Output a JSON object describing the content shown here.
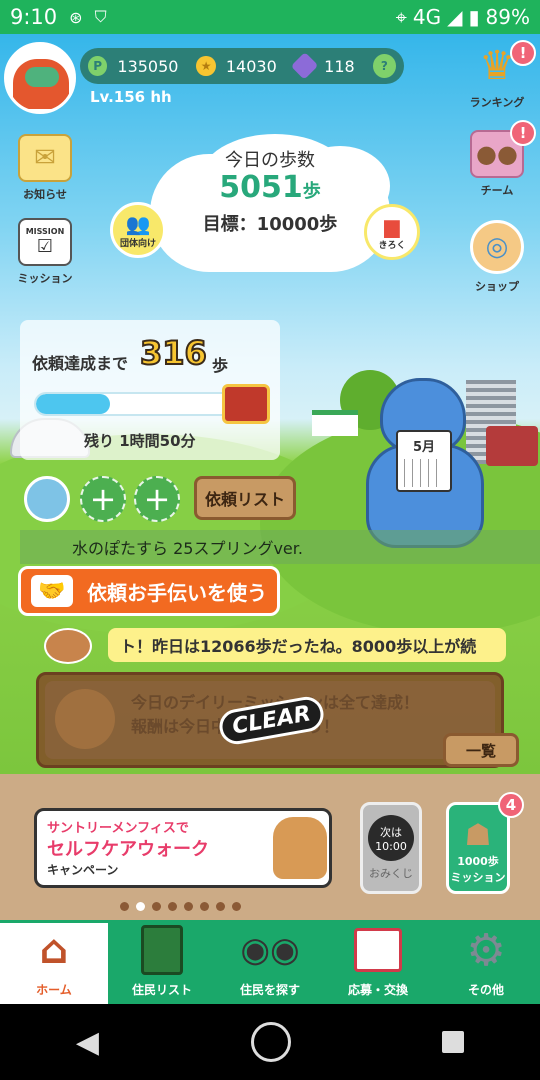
{
  "status_bar": {
    "time": "9:10",
    "network": "4G",
    "battery": "89%"
  },
  "header": {
    "points": "135050",
    "coins": "14030",
    "gems": "118",
    "help": "?",
    "level": "Lv.156 hh"
  },
  "side_left": [
    {
      "label": "お知らせ"
    },
    {
      "label": "ミッション",
      "sign": "MISSION"
    }
  ],
  "side_right": [
    {
      "label": "ランキング",
      "badge": "!"
    },
    {
      "label": "チーム",
      "badge": "!"
    },
    {
      "label": "ショップ"
    }
  ],
  "steps": {
    "title": "今日の歩数",
    "count": "5051",
    "unit": "歩",
    "goal": "目標：10000歩",
    "group_btn": "団体向け",
    "record_btn": "きろく"
  },
  "request": {
    "label": "依頼達成まで",
    "remaining_steps": "316",
    "unit": "歩",
    "progress": 0.38,
    "time_left": "残り 1時間50分",
    "list_button": "依頼リスト",
    "title": "水のぽたすら 25スプリングver.",
    "help_button": "依頼お手伝いを使う",
    "slot_add": "+",
    "calendar_month": "5月"
  },
  "ticker": "ト！昨日は12066歩だったね。8000歩以上が続",
  "daily": {
    "line1": "今日のデイリーミッションは全て達成！",
    "line2": "報酬は今日中に受け取ろう！",
    "stamp": "CLEAR",
    "list_button": "一覧"
  },
  "banner": {
    "line1": "サントリーメンフィスで",
    "line2": "セルフケアウォーク",
    "line3": "キャンペーン"
  },
  "omikuji": {
    "line1": "次は",
    "line2": "10:00",
    "caption": "おみくじ"
  },
  "mission_1000": {
    "label": "1000歩\nミッション",
    "badge": "4"
  },
  "carousel": {
    "count": 8,
    "active": 1
  },
  "tabs": [
    {
      "label": "ホーム",
      "active": true
    },
    {
      "label": "住民リスト",
      "active": false
    },
    {
      "label": "住民を探す",
      "active": false
    },
    {
      "label": "応募・交換",
      "active": false
    },
    {
      "label": "その他",
      "active": false
    }
  ],
  "colors": {
    "brand_green": "#1aa86a",
    "accent_orange": "#f26a21",
    "steps_teal": "#28a87b"
  }
}
